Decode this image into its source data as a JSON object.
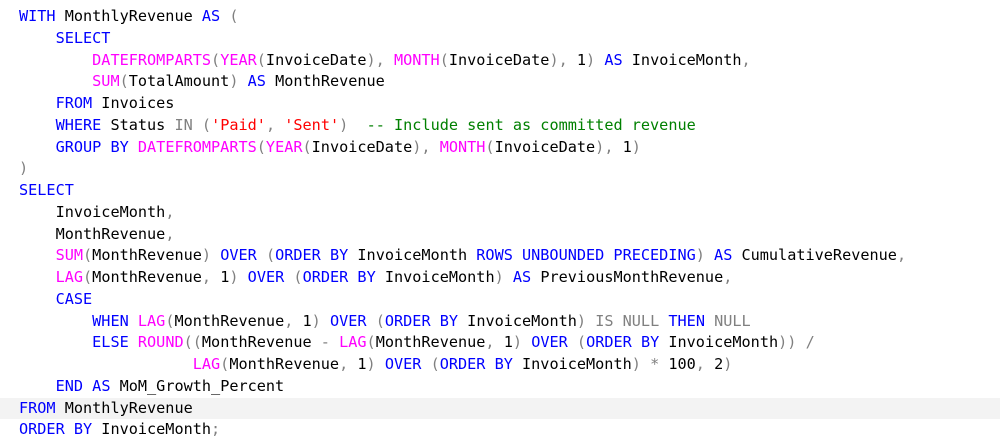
{
  "colors": {
    "keyword": "#0000ff",
    "function": "#ff00ff",
    "string": "#ff0000",
    "comment": "#008000",
    "operator": "#808080",
    "identifier": "#000000",
    "current_line_bg": "#f3f3f3"
  },
  "editor": {
    "lines": [
      {
        "indent": 0,
        "tokens": [
          [
            "kw",
            "WITH"
          ],
          [
            "id",
            " MonthlyRevenue "
          ],
          [
            "kw",
            "AS"
          ],
          [
            "id",
            " "
          ],
          [
            "op",
            "("
          ]
        ]
      },
      {
        "indent": 4,
        "tokens": [
          [
            "kw",
            "SELECT"
          ]
        ]
      },
      {
        "indent": 8,
        "tokens": [
          [
            "fn",
            "DATEFROMPARTS"
          ],
          [
            "op",
            "("
          ],
          [
            "fn",
            "YEAR"
          ],
          [
            "op",
            "("
          ],
          [
            "id",
            "InvoiceDate"
          ],
          [
            "op",
            "),"
          ],
          [
            "id",
            " "
          ],
          [
            "fn",
            "MONTH"
          ],
          [
            "op",
            "("
          ],
          [
            "id",
            "InvoiceDate"
          ],
          [
            "op",
            "),"
          ],
          [
            "id",
            " 1"
          ],
          [
            "op",
            ")"
          ],
          [
            "id",
            " "
          ],
          [
            "kw",
            "AS"
          ],
          [
            "id",
            " InvoiceMonth"
          ],
          [
            "op",
            ","
          ]
        ]
      },
      {
        "indent": 8,
        "tokens": [
          [
            "fn",
            "SUM"
          ],
          [
            "op",
            "("
          ],
          [
            "id",
            "TotalAmount"
          ],
          [
            "op",
            ")"
          ],
          [
            "id",
            " "
          ],
          [
            "kw",
            "AS"
          ],
          [
            "id",
            " MonthRevenue"
          ]
        ]
      },
      {
        "indent": 4,
        "tokens": [
          [
            "kw",
            "FROM"
          ],
          [
            "id",
            " Invoices"
          ]
        ]
      },
      {
        "indent": 4,
        "tokens": [
          [
            "kw",
            "WHERE"
          ],
          [
            "id",
            " Status "
          ],
          [
            "op",
            "IN"
          ],
          [
            "id",
            " "
          ],
          [
            "op",
            "("
          ],
          [
            "str",
            "'Paid'"
          ],
          [
            "op",
            ","
          ],
          [
            "id",
            " "
          ],
          [
            "str",
            "'Sent'"
          ],
          [
            "op",
            ")"
          ],
          [
            "id",
            "  "
          ],
          [
            "cm",
            "-- Include sent as committed revenue"
          ]
        ]
      },
      {
        "indent": 4,
        "tokens": [
          [
            "kw",
            "GROUP BY"
          ],
          [
            "id",
            " "
          ],
          [
            "fn",
            "DATEFROMPARTS"
          ],
          [
            "op",
            "("
          ],
          [
            "fn",
            "YEAR"
          ],
          [
            "op",
            "("
          ],
          [
            "id",
            "InvoiceDate"
          ],
          [
            "op",
            "),"
          ],
          [
            "id",
            " "
          ],
          [
            "fn",
            "MONTH"
          ],
          [
            "op",
            "("
          ],
          [
            "id",
            "InvoiceDate"
          ],
          [
            "op",
            "),"
          ],
          [
            "id",
            " 1"
          ],
          [
            "op",
            ")"
          ]
        ]
      },
      {
        "indent": 0,
        "tokens": [
          [
            "op",
            ")"
          ]
        ]
      },
      {
        "indent": 0,
        "tokens": [
          [
            "kw",
            "SELECT"
          ]
        ]
      },
      {
        "indent": 4,
        "tokens": [
          [
            "id",
            "InvoiceMonth"
          ],
          [
            "op",
            ","
          ]
        ]
      },
      {
        "indent": 4,
        "tokens": [
          [
            "id",
            "MonthRevenue"
          ],
          [
            "op",
            ","
          ]
        ]
      },
      {
        "indent": 4,
        "tokens": [
          [
            "fn",
            "SUM"
          ],
          [
            "op",
            "("
          ],
          [
            "id",
            "MonthRevenue"
          ],
          [
            "op",
            ")"
          ],
          [
            "id",
            " "
          ],
          [
            "kw",
            "OVER"
          ],
          [
            "id",
            " "
          ],
          [
            "op",
            "("
          ],
          [
            "kw",
            "ORDER BY"
          ],
          [
            "id",
            " InvoiceMonth "
          ],
          [
            "kw",
            "ROWS UNBOUNDED PRECEDING"
          ],
          [
            "op",
            ")"
          ],
          [
            "id",
            " "
          ],
          [
            "kw",
            "AS"
          ],
          [
            "id",
            " CumulativeRevenue"
          ],
          [
            "op",
            ","
          ]
        ]
      },
      {
        "indent": 4,
        "tokens": [
          [
            "fn",
            "LAG"
          ],
          [
            "op",
            "("
          ],
          [
            "id",
            "MonthRevenue"
          ],
          [
            "op",
            ","
          ],
          [
            "id",
            " 1"
          ],
          [
            "op",
            ")"
          ],
          [
            "id",
            " "
          ],
          [
            "kw",
            "OVER"
          ],
          [
            "id",
            " "
          ],
          [
            "op",
            "("
          ],
          [
            "kw",
            "ORDER BY"
          ],
          [
            "id",
            " InvoiceMonth"
          ],
          [
            "op",
            ")"
          ],
          [
            "id",
            " "
          ],
          [
            "kw",
            "AS"
          ],
          [
            "id",
            " PreviousMonthRevenue"
          ],
          [
            "op",
            ","
          ]
        ]
      },
      {
        "indent": 4,
        "tokens": [
          [
            "kw",
            "CASE"
          ]
        ]
      },
      {
        "indent": 8,
        "tokens": [
          [
            "kw",
            "WHEN"
          ],
          [
            "id",
            " "
          ],
          [
            "fn",
            "LAG"
          ],
          [
            "op",
            "("
          ],
          [
            "id",
            "MonthRevenue"
          ],
          [
            "op",
            ","
          ],
          [
            "id",
            " 1"
          ],
          [
            "op",
            ")"
          ],
          [
            "id",
            " "
          ],
          [
            "kw",
            "OVER"
          ],
          [
            "id",
            " "
          ],
          [
            "op",
            "("
          ],
          [
            "kw",
            "ORDER BY"
          ],
          [
            "id",
            " InvoiceMonth"
          ],
          [
            "op",
            ")"
          ],
          [
            "id",
            " "
          ],
          [
            "op",
            "IS NULL"
          ],
          [
            "id",
            " "
          ],
          [
            "kw",
            "THEN"
          ],
          [
            "id",
            " "
          ],
          [
            "op",
            "NULL"
          ]
        ]
      },
      {
        "indent": 8,
        "tokens": [
          [
            "kw",
            "ELSE"
          ],
          [
            "id",
            " "
          ],
          [
            "fn",
            "ROUND"
          ],
          [
            "op",
            "(("
          ],
          [
            "id",
            "MonthRevenue "
          ],
          [
            "op",
            "-"
          ],
          [
            "id",
            " "
          ],
          [
            "fn",
            "LAG"
          ],
          [
            "op",
            "("
          ],
          [
            "id",
            "MonthRevenue"
          ],
          [
            "op",
            ","
          ],
          [
            "id",
            " 1"
          ],
          [
            "op",
            ")"
          ],
          [
            "id",
            " "
          ],
          [
            "kw",
            "OVER"
          ],
          [
            "id",
            " "
          ],
          [
            "op",
            "("
          ],
          [
            "kw",
            "ORDER BY"
          ],
          [
            "id",
            " InvoiceMonth"
          ],
          [
            "op",
            "))"
          ],
          [
            "id",
            " "
          ],
          [
            "op",
            "/"
          ]
        ]
      },
      {
        "indent": 19,
        "tokens": [
          [
            "fn",
            "LAG"
          ],
          [
            "op",
            "("
          ],
          [
            "id",
            "MonthRevenue"
          ],
          [
            "op",
            ","
          ],
          [
            "id",
            " 1"
          ],
          [
            "op",
            ")"
          ],
          [
            "id",
            " "
          ],
          [
            "kw",
            "OVER"
          ],
          [
            "id",
            " "
          ],
          [
            "op",
            "("
          ],
          [
            "kw",
            "ORDER BY"
          ],
          [
            "id",
            " InvoiceMonth"
          ],
          [
            "op",
            ")"
          ],
          [
            "id",
            " "
          ],
          [
            "op",
            "*"
          ],
          [
            "id",
            " 100"
          ],
          [
            "op",
            ","
          ],
          [
            "id",
            " 2"
          ],
          [
            "op",
            ")"
          ]
        ]
      },
      {
        "indent": 4,
        "tokens": [
          [
            "kw",
            "END"
          ],
          [
            "id",
            " "
          ],
          [
            "kw",
            "AS"
          ],
          [
            "id",
            " MoM_Growth_Percent"
          ]
        ]
      },
      {
        "indent": 0,
        "current": true,
        "tokens": [
          [
            "kw",
            "FROM"
          ],
          [
            "id",
            " MonthlyRevenue"
          ]
        ]
      },
      {
        "indent": 0,
        "tokens": [
          [
            "kw",
            "ORDER BY"
          ],
          [
            "id",
            " InvoiceMonth"
          ],
          [
            "op",
            ";"
          ]
        ]
      }
    ]
  }
}
